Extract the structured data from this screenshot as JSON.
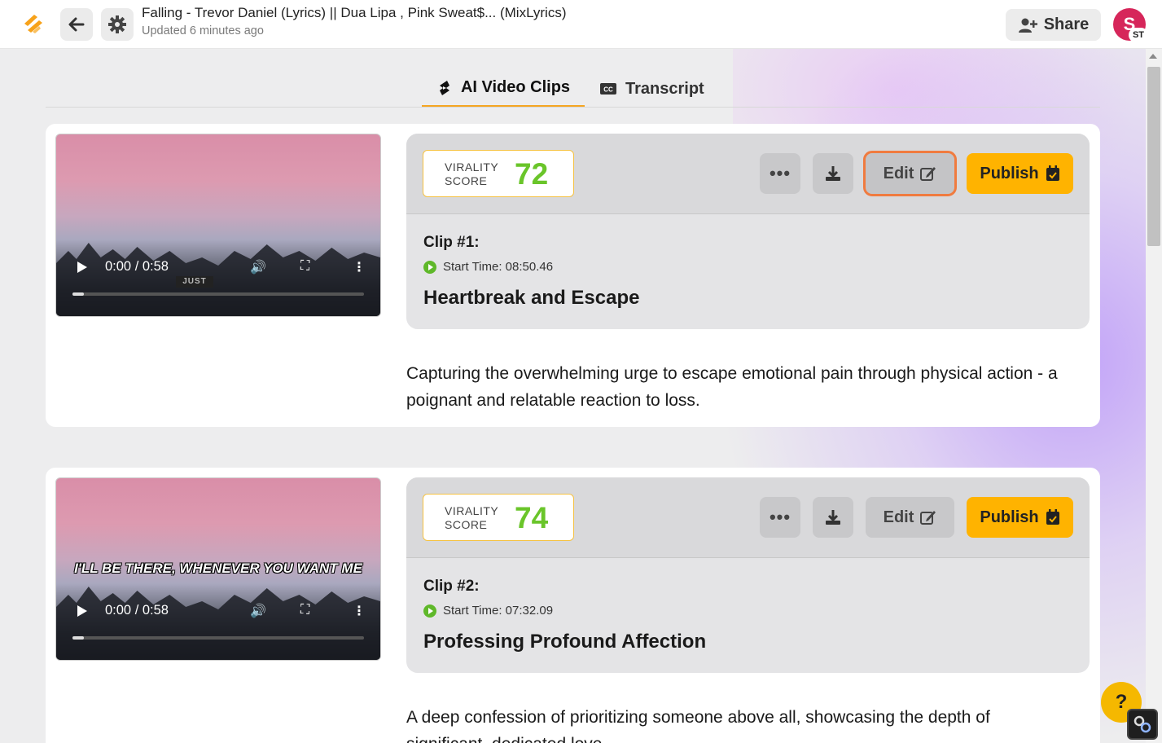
{
  "header": {
    "title": "Falling - Trevor Daniel (Lyrics) || Dua Lipa , Pink Sweat$... (MixLyrics)",
    "updated": "Updated 6 minutes ago",
    "share_label": "Share",
    "avatar_initial": "S",
    "avatar_badge": "ST"
  },
  "tabs": [
    {
      "label": "AI Video Clips",
      "active": true
    },
    {
      "label": "Transcript",
      "active": false
    }
  ],
  "clips": [
    {
      "score_label_1": "VIRALITY",
      "score_label_2": "SCORE",
      "score": "72",
      "number": "Clip #1:",
      "start_time": "Start Time: 08:50.46",
      "title": "Heartbreak and Escape",
      "description": "Capturing the overwhelming urge to escape emotional pain through physical action - a poignant and relatable reaction to loss.",
      "video_time": "0:00 / 0:58",
      "video_caption": "JUST",
      "edit_label": "Edit",
      "publish_label": "Publish"
    },
    {
      "score_label_1": "VIRALITY",
      "score_label_2": "SCORE",
      "score": "74",
      "number": "Clip #2:",
      "start_time": "Start Time: 07:32.09",
      "title": "Professing Profound Affection",
      "description": "A deep confession of prioritizing someone above all, showcasing the depth of significant, dedicated love.",
      "video_time": "0:00 / 0:58",
      "video_caption": "I'LL BE THERE, WHENEVER YOU WANT ME",
      "edit_label": "Edit",
      "publish_label": "Publish"
    }
  ],
  "help_label": "?",
  "colors": {
    "accent": "#ffb300",
    "score_green": "#6ac52a",
    "edit_focus": "#f07b3f",
    "avatar": "#d6265a"
  }
}
